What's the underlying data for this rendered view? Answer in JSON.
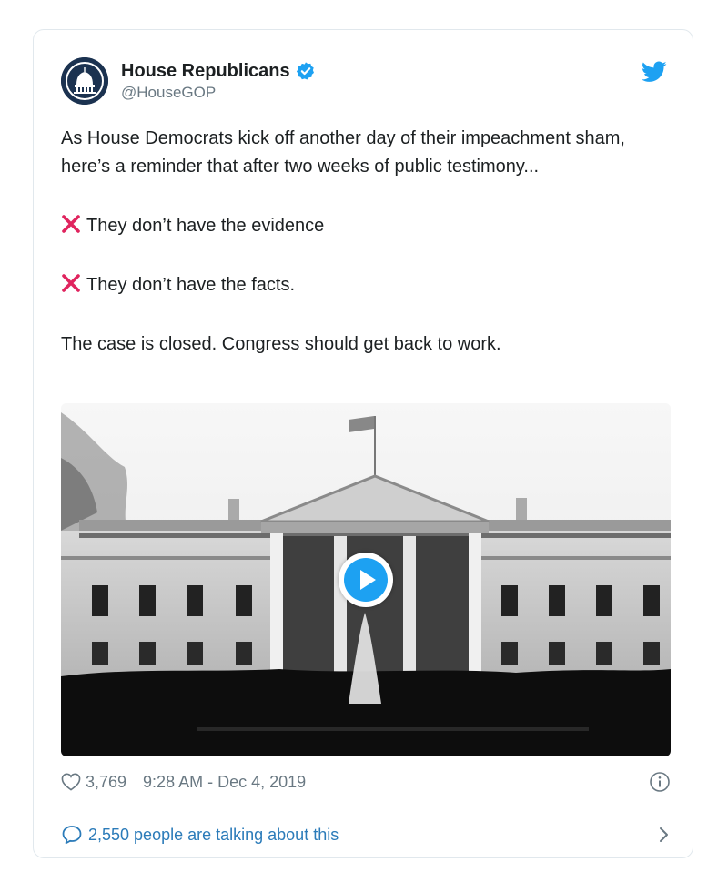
{
  "author": {
    "display_name": "House Republicans",
    "handle": "@HouseGOP",
    "verified": true,
    "avatar_icon": "capitol-dome-logo"
  },
  "platform_icon": "twitter-bird-icon",
  "tweet": {
    "line1": "As House Democrats kick off another day of their impeachment sham, here’s a reminder that after two weeks of public testimony...",
    "bullet1": "They don’t have the evidence",
    "bullet2": "They don’t have the facts.",
    "line_last": "The case is closed. Congress should get back to work."
  },
  "media": {
    "type": "video",
    "subject": "white-house-photo",
    "play_icon": "play-icon"
  },
  "meta": {
    "likes": "3,769",
    "timestamp": "9:28 AM - Dec 4, 2019"
  },
  "footer": {
    "talking_text": "2,550 people are talking about this"
  },
  "colors": {
    "accent": "#1da1f2",
    "link": "#2b7bb9",
    "x_mark": "#e0245e",
    "muted": "#697882",
    "text": "#1c2022",
    "border": "#e1e8ed"
  }
}
